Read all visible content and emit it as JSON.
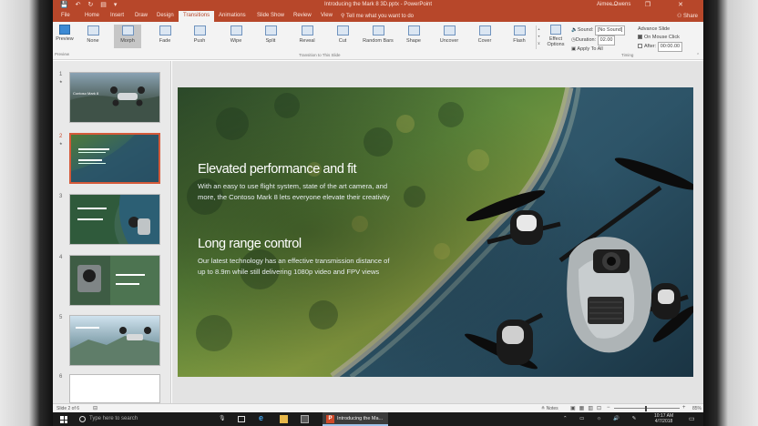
{
  "titlebar": {
    "quick_access": "💾 ↶ ↻ ▤ ▾",
    "document_title": "Introducing the Mark 8 3D.pptx  -  PowerPoint",
    "user": "Aimee Owens",
    "window_buttons": "— ❐ ✕"
  },
  "tabs": {
    "items": [
      "File",
      "Home",
      "Insert",
      "Draw",
      "Design",
      "Transitions",
      "Animations",
      "Slide Show",
      "Review",
      "View"
    ],
    "active": "Transitions",
    "tell_me": "Tell me what you want to do",
    "share": "Share"
  },
  "ribbon": {
    "preview_label": "Preview",
    "preview_group": "Preview",
    "transitions": [
      "None",
      "Morph",
      "Fade",
      "Push",
      "Wipe",
      "Split",
      "Reveal",
      "Cut",
      "Random Bars",
      "Shape",
      "Uncover",
      "Cover",
      "Flash"
    ],
    "selected_transition": "Morph",
    "transitions_group": "Transition to This Slide",
    "effect_options": "Effect Options",
    "sound_label": "Sound:",
    "sound_value": "[No Sound]",
    "duration_label": "Duration:",
    "duration_value": "02.00",
    "apply_to_all": "Apply To All",
    "advance_slide": "Advance Slide",
    "on_mouse_click": "On Mouse Click",
    "on_mouse_click_checked": true,
    "after_label": "After:",
    "after_value": "00:00.00",
    "timing_group": "Timing"
  },
  "thumbnails": {
    "numbers": [
      "1",
      "2",
      "3",
      "4",
      "5",
      "6"
    ],
    "selected_index": 2,
    "slide1_caption": "Contoso Mark 8",
    "marker_glyph": "★"
  },
  "slide": {
    "heading1": "Elevated performance and fit",
    "body1_line1": "With an easy to use flight system, state of the art camera, and",
    "body1_line2": "more, the Contoso Mark 8 lets everyone elevate their creativity",
    "heading2": "Long range control",
    "body2_line1": "Our latest technology has an effective transmission distance of",
    "body2_line2": "up to 8.9m while still delivering 1080p video and FPV views"
  },
  "statusbar": {
    "slide_info": "Slide 2 of 6",
    "notes": "≙ Notes",
    "zoom": "85%"
  },
  "taskbar": {
    "search_placeholder": "Type here to search",
    "powerpoint_task": "Introducing the Ma...",
    "clock_time": "10:17 AM",
    "clock_date": "4/7/2018",
    "tray": "⌃ ▭ ☼ 🔊 ✎"
  },
  "colors": {
    "accent": "#b7472a",
    "ribbon_bg": "#f3f3f3",
    "thumb_selected": "#d55a3a",
    "taskbar": "#1b1b1b"
  }
}
